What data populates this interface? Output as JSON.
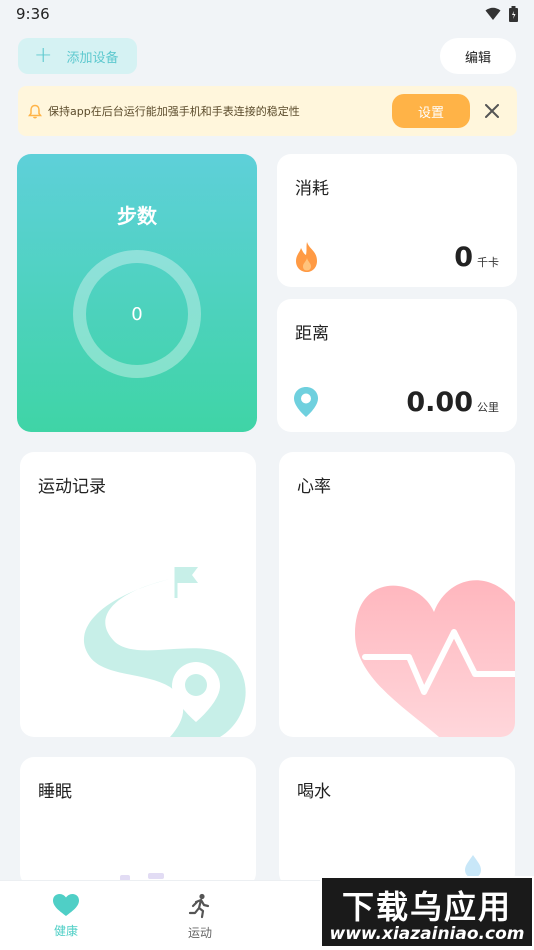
{
  "statusbar": {
    "time": "9:36"
  },
  "topbar": {
    "add_device_label": "添加设备",
    "edit_label": "编辑"
  },
  "notice": {
    "text": "保持app在后台运行能加强手机和手表连接的稳定性",
    "settings_label": "设置"
  },
  "cards": {
    "steps": {
      "title": "步数",
      "value": "0"
    },
    "energy": {
      "title": "消耗",
      "value": "0",
      "unit": "千卡"
    },
    "distance": {
      "title": "距离",
      "value": "0.00",
      "unit": "公里"
    },
    "records": {
      "title": "运动记录"
    },
    "heart_rate": {
      "title": "心率"
    },
    "sleep": {
      "title": "睡眠"
    },
    "water": {
      "title": "喝水"
    }
  },
  "tabbar": {
    "items": [
      {
        "label": "健康",
        "icon": "heart-icon",
        "active": true
      },
      {
        "label": "运动",
        "icon": "running-icon",
        "active": false
      }
    ]
  },
  "watermark": {
    "title": "下载乌应用",
    "url": "www.xiazainiao.com"
  },
  "colors": {
    "accent": "#4fcfc6",
    "steps_gradient_top": "#5ed0d9",
    "steps_gradient_bottom": "#3fd4a6",
    "notice_bg": "#fff6dc",
    "notice_button": "#ffb347",
    "background": "#f1f4f7"
  }
}
